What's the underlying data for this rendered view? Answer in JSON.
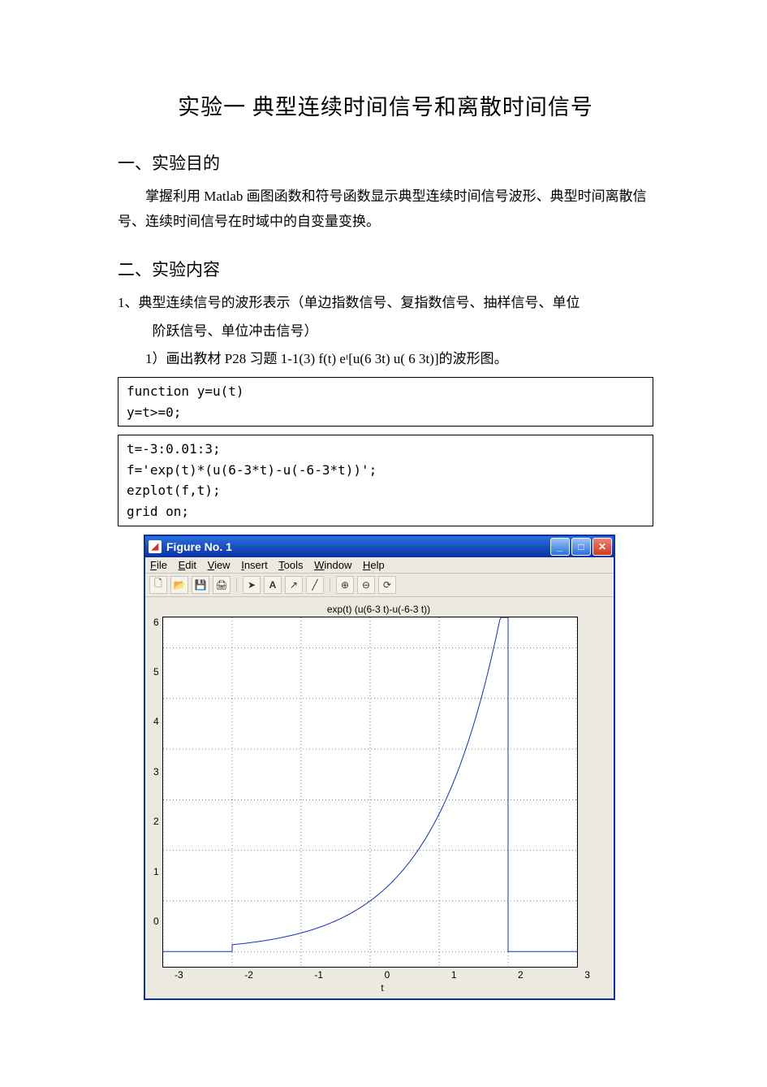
{
  "title": "实验一   典型连续时间信号和离散时间信号",
  "section1": {
    "heading": "一、实验目的",
    "para": "掌握利用 Matlab 画图函数和符号函数显示典型连续时间信号波形、典型时间离散信号、连续时间信号在时域中的自变量变换。"
  },
  "section2": {
    "heading": "二、实验内容",
    "item1_line1": "1、典型连续信号的波形表示（单边指数信号、复指数信号、抽样信号、单位",
    "item1_line2": "阶跃信号、单位冲击信号）",
    "subitem1": "1）画出教材 P28 习题 1-1(3) f(t)   eᵗ[u(6   3t)   u( 6   3t)]的波形图。"
  },
  "code1": "function y=u(t)\ny=t>=0;",
  "code2": "t=-3:0.01:3;\nf='exp(t)*(u(6-3*t)-u(-6-3*t))';\nezplot(f,t);\ngrid on;",
  "figure": {
    "window_title": "Figure No. 1",
    "menu": [
      "File",
      "Edit",
      "View",
      "Insert",
      "Tools",
      "Window",
      "Help"
    ],
    "toolbar_icons": [
      "new-file-icon",
      "open-icon",
      "save-icon",
      "print-icon",
      "sep",
      "pointer-icon",
      "text-a-icon",
      "arrow-icon",
      "line-icon",
      "sep",
      "zoom-in-icon",
      "zoom-out-icon",
      "rotate-icon"
    ],
    "plot_title": "exp(t) (u(6-3 t)-u(-6-3 t))",
    "xlabel": "t",
    "xticks": [
      "-3",
      "-2",
      "-1",
      "0",
      "1",
      "2",
      "3"
    ],
    "yticks": [
      "6",
      "5",
      "4",
      "3",
      "2",
      "1",
      "0",
      ""
    ]
  },
  "chart_data": {
    "type": "line",
    "title": "exp(t) (u(6-3 t)-u(-6-3 t))",
    "xlabel": "t",
    "ylabel": "",
    "xlim": [
      -3,
      3
    ],
    "ylim": [
      -0.3,
      6.6
    ],
    "xticks": [
      -3,
      -2,
      -1,
      0,
      1,
      2,
      3
    ],
    "yticks": [
      0,
      1,
      2,
      3,
      4,
      5,
      6
    ],
    "series": [
      {
        "name": "exp(t)*(u(6-3t)-u(-6-3t))",
        "x": [
          -3.0,
          -2.0,
          -2.0,
          -1.5,
          -1.0,
          -0.5,
          0.0,
          0.5,
          1.0,
          1.5,
          2.0,
          2.0,
          3.0
        ],
        "y": [
          0.0,
          0.0,
          0.135,
          0.223,
          0.368,
          0.607,
          1.0,
          1.649,
          2.718,
          4.482,
          7.389,
          0.0,
          0.0
        ]
      }
    ],
    "grid": true
  }
}
